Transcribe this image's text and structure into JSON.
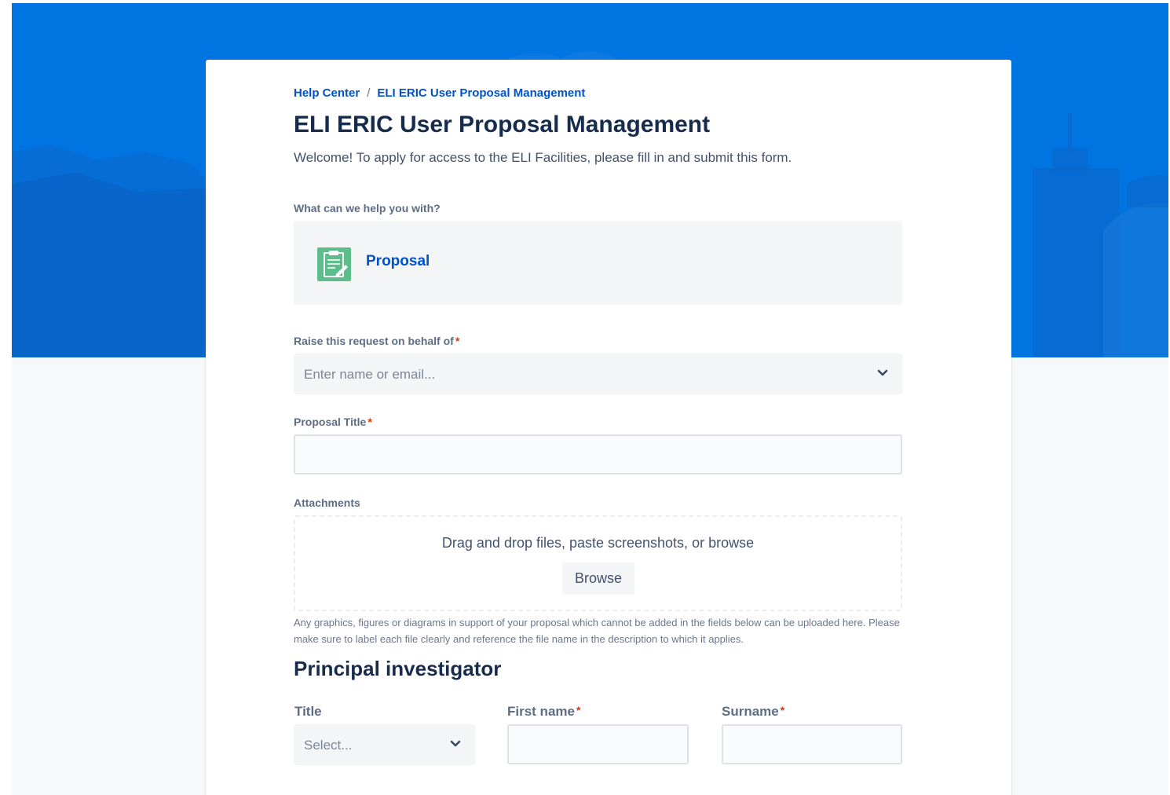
{
  "breadcrumb": {
    "home": "Help Center",
    "separator": "/",
    "current": "ELI ERIC User Proposal Management"
  },
  "page": {
    "title": "ELI ERIC User Proposal Management",
    "welcome": "Welcome! To apply for access to the ELI Facilities, please fill in and submit this form."
  },
  "request_type": {
    "question": "What can we help you with?",
    "selected": "Proposal",
    "icon": "clipboard-icon"
  },
  "form": {
    "behalf": {
      "label": "Raise this request on behalf of",
      "required_mark": "*",
      "placeholder": "Enter name or email..."
    },
    "proposal_title": {
      "label": "Proposal Title",
      "required_mark": "*",
      "value": ""
    },
    "attachments": {
      "label": "Attachments",
      "drop_text": "Drag and drop files, paste screenshots, or browse",
      "browse_label": "Browse",
      "help": "Any graphics, figures or diagrams in support of your proposal which cannot be added in the fields below can be uploaded here. Please make sure to label each file clearly and reference the file name in the description to which it applies."
    },
    "principal_investigator": {
      "section_title": "Principal investigator",
      "title_field": {
        "label": "Title",
        "placeholder": "Select..."
      },
      "first_name": {
        "label": "First name",
        "required_mark": "*",
        "value": ""
      },
      "surname": {
        "label": "Surname",
        "required_mark": "*",
        "value": ""
      }
    }
  },
  "colors": {
    "hero_blue": "#0074e0",
    "link_blue": "#0052cc",
    "required_red": "#de350b",
    "icon_green": "#5dbd8b"
  }
}
